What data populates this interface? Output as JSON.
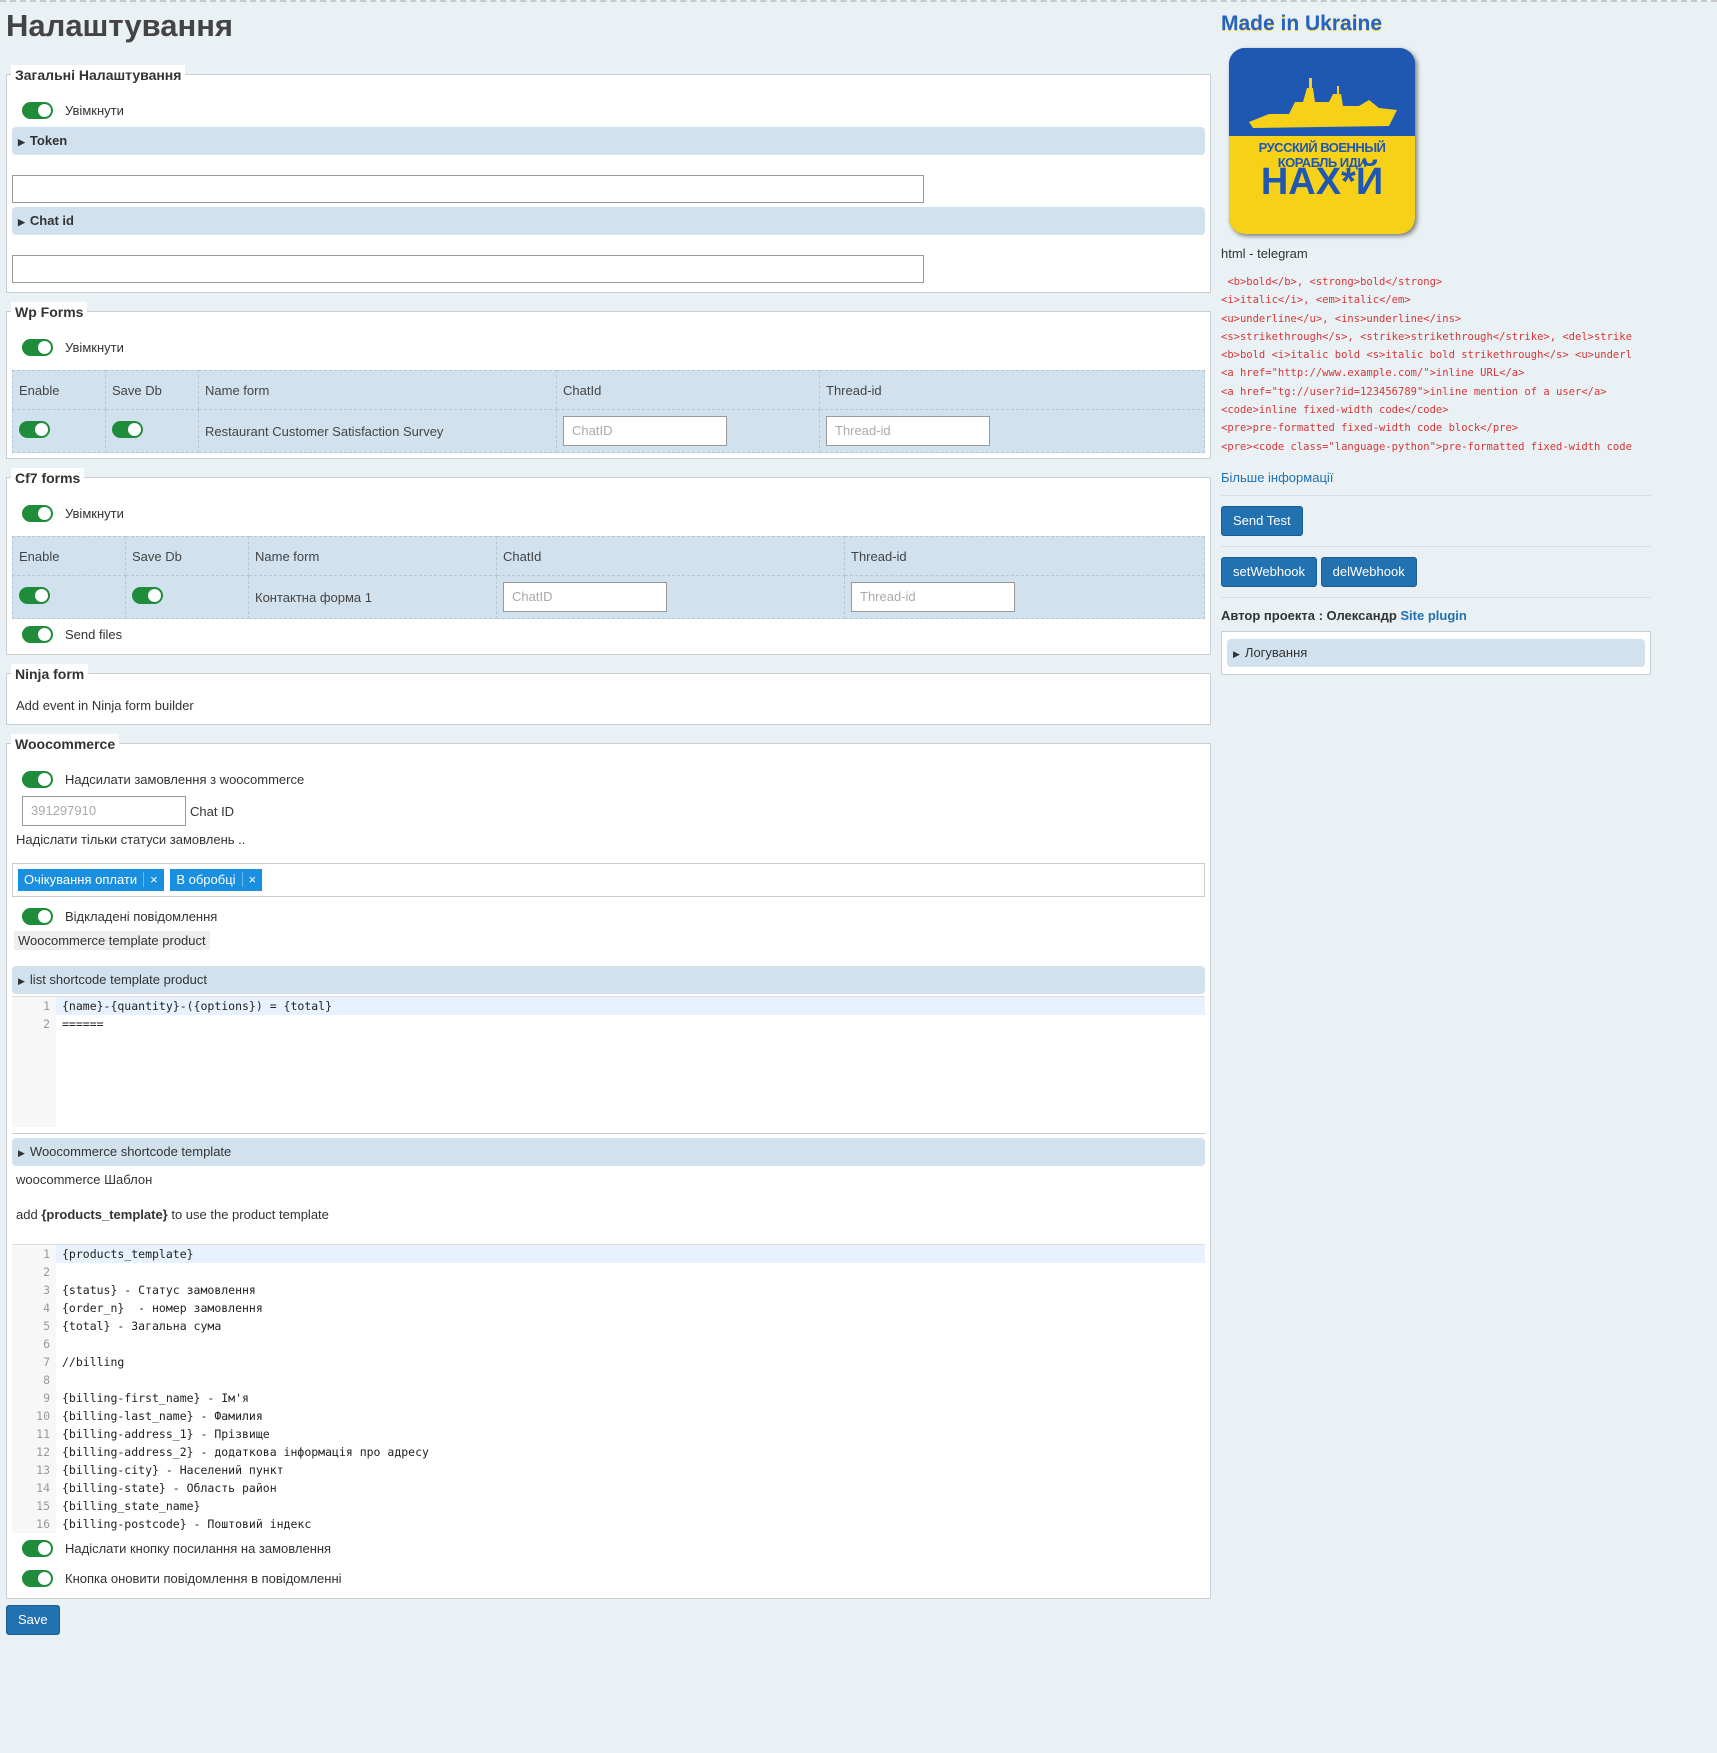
{
  "page_title": "Налаштування",
  "general": {
    "legend": "Загальні Налаштування",
    "enable_label": "Увімкнути",
    "token_label": "Token",
    "chat_id_label": "Chat id"
  },
  "wpforms": {
    "legend": "Wp Forms",
    "enable_label": "Увімкнути",
    "columns": [
      "Enable",
      "Save Db",
      "Name form",
      "ChatId",
      "Thread-id"
    ],
    "rows": [
      {
        "name": "Restaurant Customer Satisfaction Survey",
        "chatid_placeholder": "ChatID",
        "thread_placeholder": "Thread-id"
      }
    ]
  },
  "cf7": {
    "legend": "Cf7 forms",
    "enable_label": "Увімкнути",
    "columns": [
      "Enable",
      "Save Db",
      "Name form",
      "ChatId",
      "Thread-id"
    ],
    "rows": [
      {
        "name": "Контактна форма 1",
        "chatid_placeholder": "ChatID",
        "thread_placeholder": "Thread-id"
      }
    ],
    "send_files_label": "Send files"
  },
  "ninja": {
    "legend": "Ninja form",
    "text": "Add event in Ninja form builder"
  },
  "woo": {
    "legend": "Woocommerce",
    "send_orders_label": "Надсилати замовлення з woocommerce",
    "chat_id_placeholder": "391297910",
    "chat_id_label": "Chat ID",
    "statuses_text": "Надіслати тільки статуси замовлень ..",
    "status_tags": [
      "Очікування оплати",
      "В обробці"
    ],
    "deferred_label": "Відкладені повідомлення",
    "template_product_label": "Woocommerce template product",
    "list_shortcode_label": "list shortcode template product",
    "product_template_lines": [
      "{name}-{quantity}-({options}) = {total}",
      "======"
    ],
    "shortcode_template_label": "Woocommerce shortcode template",
    "template_title": "woocommerce Шаблон",
    "add_prefix": "add ",
    "add_code": "{products_template}",
    "add_suffix": " to use the product template",
    "template_lines": [
      "{products_template}",
      "",
      "{status} - Статус замовлення",
      "{order_n}  - номер замовлення",
      "{total} - Загальна сума",
      "",
      "//billing",
      "",
      "{billing-first_name} - Ім'я",
      "{billing-last_name} - Фамилия",
      "{billing-address_1} - Прізвище",
      "{billing-address_2} - додаткова інформація про адресу",
      "{billing-city} - Населений пункт",
      "{billing-state} - Область район",
      "{billing_state_name}",
      "{billing-postcode} - Поштовий індекс"
    ],
    "order_link_label": "Надіслати кнопку посилання на замовлення",
    "refresh_button_label": "Кнопка оновити повідомлення в повідомленні"
  },
  "save_label": "Save",
  "sidebar": {
    "made_in": "Made in Ukraine",
    "poster_top": "РУССКИЙ ВОЕННЫЙ КОРАБЛЬ ИДИ",
    "poster_bottom": "НАХ*Й",
    "html_label": "html - telegram",
    "html_lines": [
      " <b>bold</b>, <strong>bold</strong>",
      "<i>italic</i>, <em>italic</em>",
      "<u>underline</u>, <ins>underline</ins>",
      "<s>strikethrough</s>, <strike>strikethrough</strike>, <del>strike",
      "<b>bold <i>italic bold <s>italic bold strikethrough</s> <u>underl",
      "<a href=\"http://www.example.com/\">inline URL</a>",
      "<a href=\"tg://user?id=123456789\">inline mention of a user</a>",
      "<code>inline fixed-width code</code>",
      "<pre>pre-formatted fixed-width code block</pre>",
      "<pre><code class=\"language-python\">pre-formatted fixed-width code"
    ],
    "more_info": "Більше інформації",
    "send_test": "Send Test",
    "set_webhook": "setWebhook",
    "del_webhook": "delWebhook",
    "author_prefix": "Автор проекта : Олександр ",
    "author_link": "Site plugin",
    "logging_label": "Логування"
  },
  "colors": {
    "accent": "#2271b1",
    "toggle_on": "#1e8c3b",
    "section_bar": "#d1e2ee",
    "tag": "#1a8fe0",
    "code_red": "#d63638"
  }
}
